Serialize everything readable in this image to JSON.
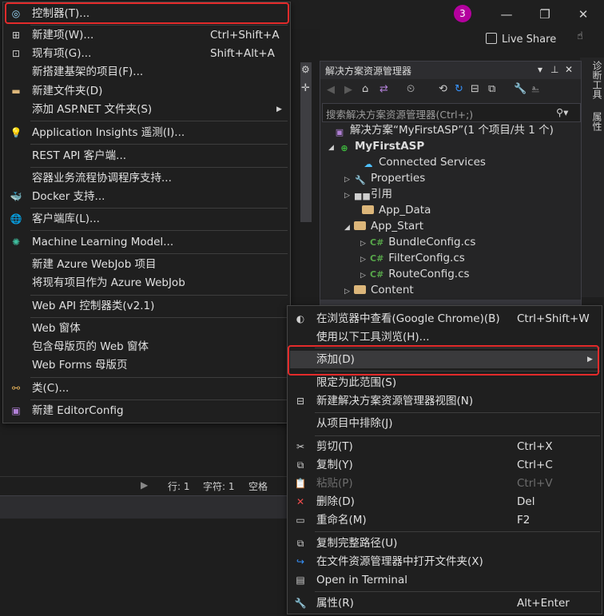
{
  "title_bar": {
    "notification_count": "3",
    "live_share": "Live Share"
  },
  "right_strip": {
    "tab1": "诊断工具",
    "tab2": "属性"
  },
  "status": {
    "line": "行: 1",
    "col": "字符: 1",
    "spaces": "空格"
  },
  "solution_explorer": {
    "title": "解决方案资源管理器",
    "search_placeholder": "搜索解决方案资源管理器(Ctrl+;)",
    "solution": "解决方案“MyFirstASP”(1 个项目/共 1 个)",
    "project": "MyFirstASP",
    "items": {
      "connected": "Connected Services",
      "properties": "Properties",
      "references": "引用",
      "app_data": "App_Data",
      "app_start": "App_Start",
      "bundle": "BundleConfig.cs",
      "filter": "FilterConfig.cs",
      "route": "RouteConfig.cs",
      "content": "Content"
    }
  },
  "add_menu": {
    "controller": "控制器(T)...",
    "new_item": "新建项(W)...",
    "new_item_sc": "Ctrl+Shift+A",
    "existing_item": "现有项(G)...",
    "existing_item_sc": "Shift+Alt+A",
    "scaffold": "新搭建基架的项目(F)...",
    "new_folder": "新建文件夹(D)",
    "aspnet_folder": "添加 ASP.NET 文件夹(S)",
    "app_insights": "Application Insights 遥测(I)...",
    "rest_client": "REST API 客户端...",
    "container": "容器业务流程协调程序支持...",
    "docker": "Docker 支持...",
    "client_lib": "客户端库(L)...",
    "ml_model": "Machine Learning Model...",
    "webjob_new": "新建 Azure WebJob 项目",
    "webjob_existing": "将现有项目作为 Azure WebJob",
    "webapi": "Web API 控制器类(v2.1)",
    "webform": "Web 窗体",
    "webform_master": "包含母版页的 Web 窗体",
    "master_page": "Web Forms 母版页",
    "class": "类(C)...",
    "editorconfig": "新建 EditorConfig"
  },
  "context_menu": {
    "view_in_browser": "在浏览器中查看(Google Chrome)(B)",
    "view_in_browser_sc": "Ctrl+Shift+W",
    "browse_with": "使用以下工具浏览(H)...",
    "add": "添加(D)",
    "scope": "限定为此范围(S)",
    "new_view": "新建解决方案资源管理器视图(N)",
    "exclude": "从项目中排除(J)",
    "cut": "剪切(T)",
    "cut_sc": "Ctrl+X",
    "copy": "复制(Y)",
    "copy_sc": "Ctrl+C",
    "paste": "粘贴(P)",
    "paste_sc": "Ctrl+V",
    "delete": "删除(D)",
    "delete_sc": "Del",
    "rename": "重命名(M)",
    "rename_sc": "F2",
    "copy_path": "复制完整路径(U)",
    "open_folder": "在文件资源管理器中打开文件夹(X)",
    "open_terminal": "Open in Terminal",
    "properties": "属性(R)",
    "properties_sc": "Alt+Enter"
  }
}
